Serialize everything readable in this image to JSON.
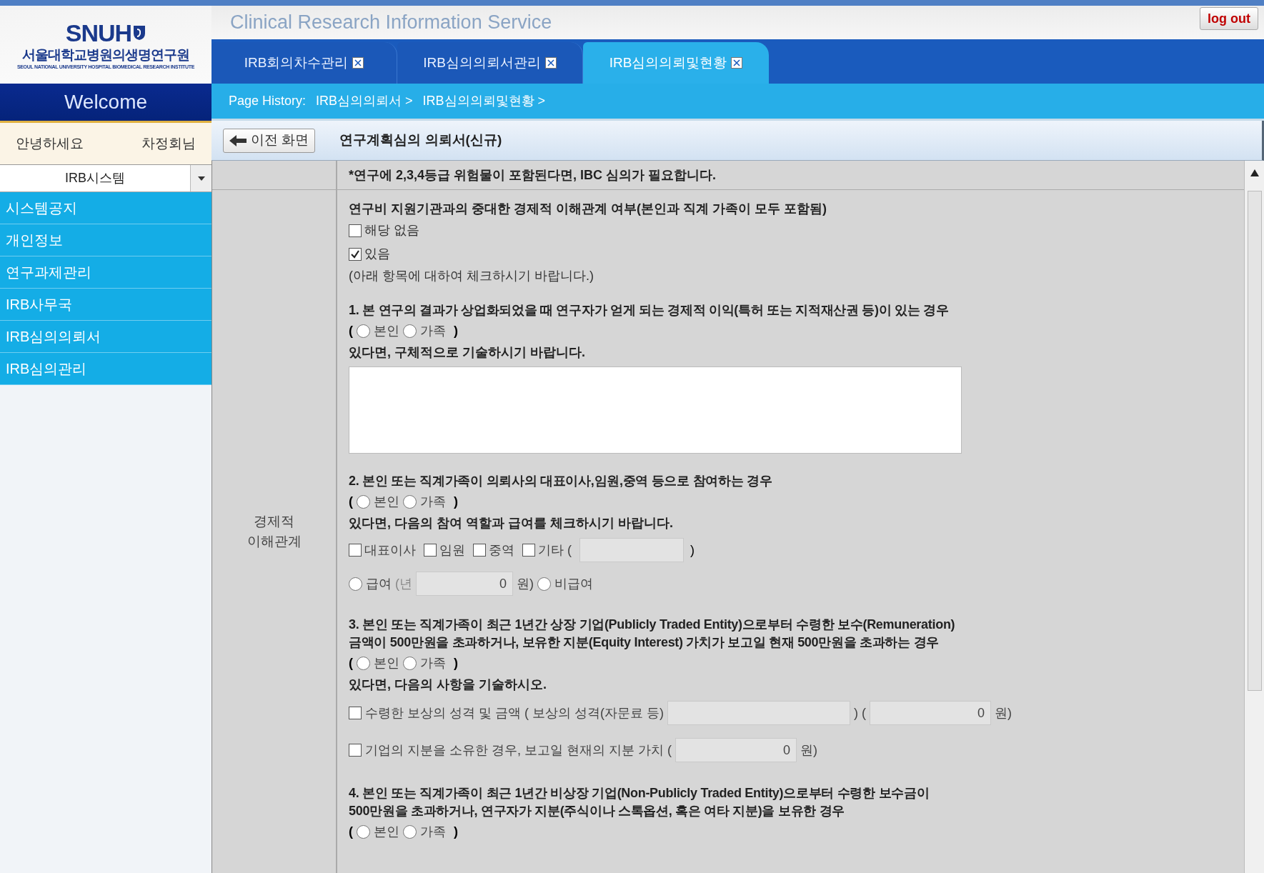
{
  "header": {
    "logo": "SNUH",
    "logo_subtitle": "서울대학교병원의생명연구원",
    "logo_subtitle_en": "SEOUL NATIONAL UNIVERSITY HOSPITAL BIOMEDICAL RESEARCH INSTITUTE",
    "service_title": "Clinical Research Information Service",
    "logout": "log out"
  },
  "tabs": [
    {
      "label": "IRB회의차수관리",
      "selected": false
    },
    {
      "label": "IRB심의의뢰서관리",
      "selected": false
    },
    {
      "label": "IRB심의의뢰및현황",
      "selected": true
    }
  ],
  "page_history": {
    "label": "Page History:",
    "items": [
      "IRB심의의뢰서 >",
      "IRB심의의뢰및현황 >"
    ]
  },
  "sidebar": {
    "welcome": "Welcome",
    "greeting": "안녕하세요",
    "user": "차정회님",
    "system_select": "IRB시스템",
    "items": [
      "시스템공지",
      "개인정보",
      "연구과제관리",
      "IRB사무국",
      "IRB심의의뢰서",
      "IRB심의관리"
    ]
  },
  "toolbar": {
    "back_button": "이전 화면",
    "title": "연구계획심의 의뢰서(신규)"
  },
  "form": {
    "notice": "*연구에 2,3,4등급 위험물이 포함된다면, IBC 심의가 필요합니다.",
    "section_label": "경제적 이해관계",
    "blocks": [
      {
        "kind": "heading",
        "text": "연구비 지원기관과의 중대한 경제적 이해관계 여부(본인과 직계 가족이 모두 포함됨)"
      },
      {
        "kind": "checkbox",
        "label": "해당 없음",
        "checked": false
      },
      {
        "kind": "checkbox",
        "label": "있음",
        "checked": true
      },
      {
        "kind": "note",
        "text": "(아래 항목에 대하여 체크하시기 바랍니다.)"
      },
      {
        "kind": "question",
        "lines": [
          "1. 본 연구의 결과가 상업화되었을 때 연구자가 얻게 되는 경제적 이익(특허 또는 지적재산권 등)이 있는 경우"
        ]
      },
      {
        "kind": "radios",
        "open": "(",
        "close": ")",
        "options": [
          {
            "label": "본인",
            "selected": false
          },
          {
            "label": "가족",
            "selected": false
          }
        ]
      },
      {
        "kind": "heading",
        "text": "있다면, 구체적으로 기술하시기 바랍니다."
      },
      {
        "kind": "textarea"
      },
      {
        "kind": "question",
        "lines": [
          "2. 본인 또는 직계가족이 의뢰사의 대표이사,임원,중역 등으로 참여하는 경우"
        ]
      },
      {
        "kind": "radios",
        "open": "(",
        "close": ")",
        "options": [
          {
            "label": "본인",
            "selected": false
          },
          {
            "label": "가족",
            "selected": false
          }
        ]
      },
      {
        "kind": "heading",
        "text": "있다면, 다음의 참여 역할과 급여를 체크하시기 바랍니다."
      },
      {
        "kind": "checkrow",
        "items": [
          {
            "label": "대표이사",
            "checked": false
          },
          {
            "label": "임원",
            "checked": false
          },
          {
            "label": "중역",
            "checked": false
          },
          {
            "label": "기타 (",
            "checked": false
          }
        ],
        "suffix": ")"
      },
      {
        "kind": "salary",
        "options": [
          {
            "label": "급여",
            "selected": false,
            "prefix": "(년",
            "value": "0",
            "unit": "원)"
          },
          {
            "label": "비급여",
            "selected": false
          }
        ]
      },
      {
        "kind": "question",
        "lines": [
          "3. 본인 또는 직계가족이 최근 1년간 상장 기업(Publicly Traded Entity)으로부터 수령한 보수(Remuneration)",
          "금액이 500만원을 초과하거나, 보유한 지분(Equity Interest) 가치가 보고일 현재 500만원을 초과하는 경우"
        ]
      },
      {
        "kind": "radios",
        "open": "(",
        "close": ")",
        "options": [
          {
            "label": "본인",
            "selected": false
          },
          {
            "label": "가족",
            "selected": false
          }
        ]
      },
      {
        "kind": "heading",
        "text": "있다면, 다음의 사항을 기술하시오."
      },
      {
        "kind": "amount",
        "checked": false,
        "parts": [
          {
            "kind": "text",
            "text": "수령한 보상의 성격 및 금액 ( 보상의 성격(자문료 등)"
          },
          {
            "kind": "field"
          },
          {
            "kind": "text",
            "text": ") ("
          },
          {
            "kind": "field",
            "value": "0"
          },
          {
            "kind": "text",
            "text": "원)"
          }
        ]
      },
      {
        "kind": "amount",
        "checked": false,
        "parts": [
          {
            "kind": "text",
            "text": "기업의 지분을 소유한 경우, 보고일 현재의 지분 가치 ("
          },
          {
            "kind": "field",
            "value": "0"
          },
          {
            "kind": "text",
            "text": "원)"
          }
        ]
      },
      {
        "kind": "question",
        "lines": [
          "4. 본인 또는 직계가족이 최근 1년간 비상장 기업(Non-Publicly Traded Entity)으로부터 수령한 보수금이",
          "500만원을 초과하거나, 연구자가 지분(주식이나 스톡옵션, 혹은 여타 지분)을 보유한 경우"
        ]
      },
      {
        "kind": "radios",
        "open": "(",
        "close": ")",
        "options": [
          {
            "label": "본인",
            "selected": false
          },
          {
            "label": "가족",
            "selected": false
          }
        ]
      }
    ]
  }
}
